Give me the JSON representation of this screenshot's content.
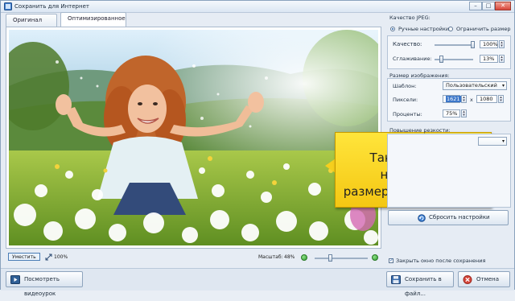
{
  "window": {
    "title": "Сохранить для Интернет",
    "minimize_label": "–",
    "maximize_label": "□",
    "close_label": "✕"
  },
  "tabs": [
    {
      "label": "Оригинал"
    },
    {
      "label": "Оптимизированное"
    }
  ],
  "callout": {
    "line1": "Также можно настроить",
    "line2": "размер фото вручную"
  },
  "statusbar": {
    "fit_label": "Уместить",
    "scale_percent": "100%",
    "zoom_label": "Масштаб:",
    "zoom_value": "48%"
  },
  "jpeg": {
    "section_label": "Качество JPEG:",
    "radio_manual": "Ручные настройки",
    "radio_limit": "Ограничить размер",
    "quality_label": "Качество:",
    "quality_value": "100%",
    "smoothing_label": "Сглаживание:",
    "smoothing_value": "13%",
    "quality_level": 1.0,
    "smoothing_level": 0.13
  },
  "size": {
    "section_label": "Размер изображения:",
    "template_label": "Шаблон:",
    "template_value": "Пользовательский",
    "pixels_label": "Пиксели:",
    "width_value": "1621",
    "height_value": "1080",
    "x_label": "x",
    "percent_label": "Проценты:",
    "percent_value": "75%"
  },
  "sharpen": {
    "section_label": "Повышение резкости:"
  },
  "reset_button": "Сбросить настройки",
  "close_after_save": {
    "label": "Закрыть окно после сохранения",
    "checked": true
  },
  "bottom": {
    "video_button": "Посмотреть видеоурок",
    "save_button": "Сохранить в файл...",
    "cancel_button": "Отмена"
  },
  "colors": {
    "accent": "#3b76c9",
    "callout_bg": "#f6cf1d",
    "zoom_button": "#2f9a2c"
  },
  "icons": {
    "app": "app-icon",
    "fit": "fit-icon",
    "zoom_out": "zoom-out-icon",
    "zoom_in": "zoom-in-icon",
    "reset": "reset-icon",
    "video": "video-icon",
    "save": "save-icon",
    "cancel": "cancel-icon"
  }
}
